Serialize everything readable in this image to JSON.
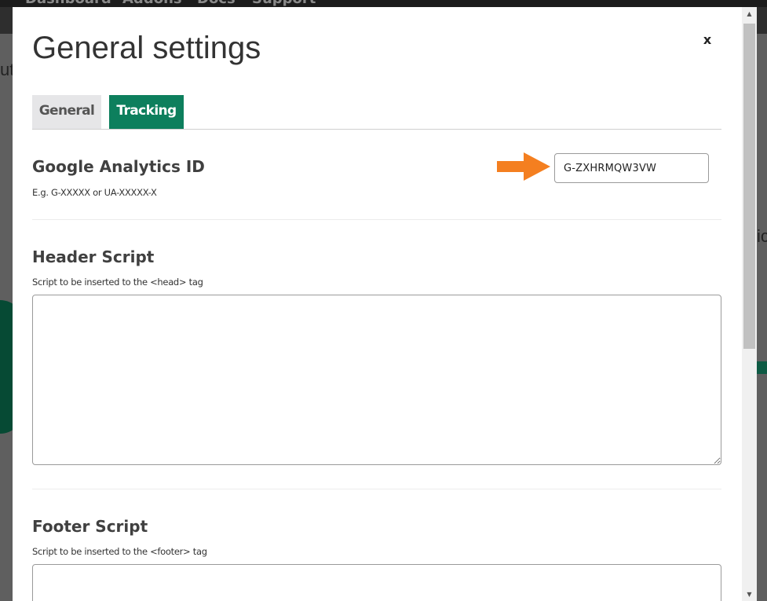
{
  "background": {
    "nav_links": [
      "Dashboard",
      "Addons",
      "Docs",
      "Support"
    ],
    "ghost_left": "ut",
    "ghost_right": "ic"
  },
  "modal": {
    "title": "General settings",
    "close_label": "x"
  },
  "tabs": [
    {
      "label": "General",
      "active": false
    },
    {
      "label": "Tracking",
      "active": true
    }
  ],
  "fields": {
    "google_analytics": {
      "heading": "Google Analytics ID",
      "help": "E.g. G-XXXXX or UA-XXXXX-X",
      "value": "G-ZXHRMQW3VW"
    },
    "header_script": {
      "heading": "Header Script",
      "help": "Script to be inserted to the <head> tag",
      "value": ""
    },
    "footer_script": {
      "heading": "Footer Script",
      "help": "Script to be inserted to the <footer> tag",
      "value": ""
    }
  },
  "colors": {
    "accent": "#0d7f5d",
    "arrow": "#f47f20",
    "tab_inactive": "#e6e6e8"
  },
  "icons": {
    "close": "close-icon",
    "arrow": "arrow-right-icon",
    "resize": "resize-grip-icon"
  }
}
